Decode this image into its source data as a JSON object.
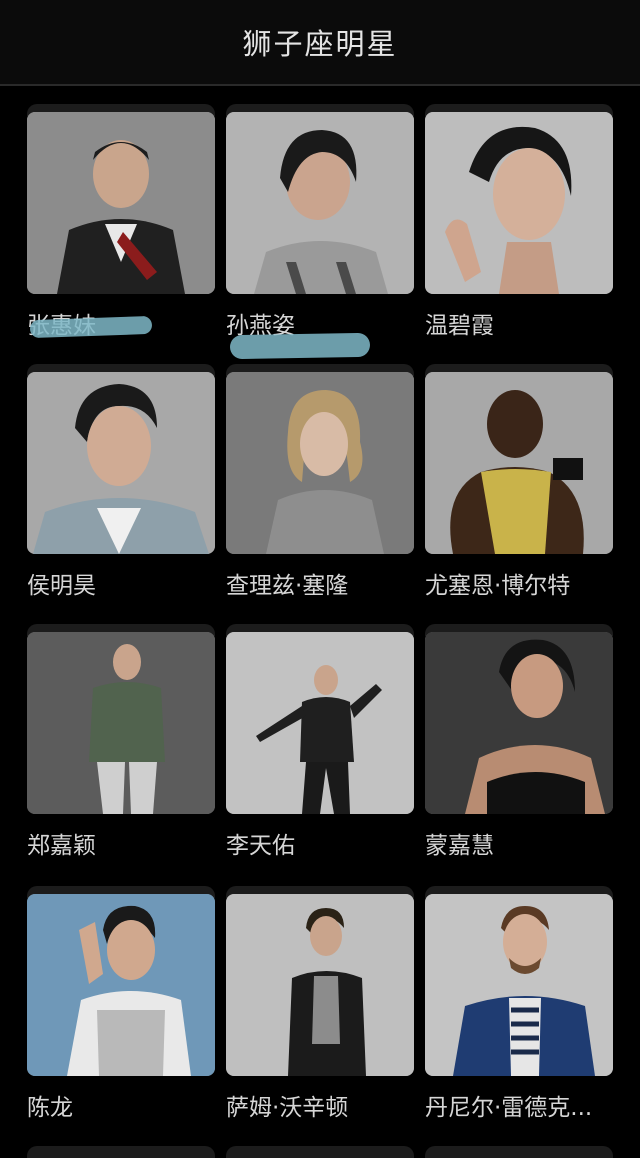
{
  "header": {
    "title": "狮子座明星"
  },
  "celebrities": [
    {
      "name": "张惠妹",
      "photo_icon": "person-photo-icon"
    },
    {
      "name": "孙燕姿",
      "photo_icon": "person-photo-icon"
    },
    {
      "name": "温碧霞",
      "photo_icon": "person-photo-icon"
    },
    {
      "name": "侯明昊",
      "photo_icon": "person-photo-icon"
    },
    {
      "name": "查理兹·塞隆",
      "photo_icon": "person-photo-icon"
    },
    {
      "name": "尤塞恩·博尔特",
      "photo_icon": "person-photo-icon"
    },
    {
      "name": "郑嘉颖",
      "photo_icon": "person-photo-icon"
    },
    {
      "name": "李天佑",
      "photo_icon": "person-photo-icon"
    },
    {
      "name": "蒙嘉慧",
      "photo_icon": "person-photo-icon"
    },
    {
      "name": "陈龙",
      "photo_icon": "person-photo-icon"
    },
    {
      "name": "萨姆·沃辛顿",
      "photo_icon": "person-photo-icon"
    },
    {
      "name": "丹尼尔·雷德克...",
      "photo_icon": "person-photo-icon"
    }
  ],
  "colors": {
    "background": "#000000",
    "header_bg": "#0b0b0b",
    "text": "#d6d6d6",
    "scribble": "#7fb8c8"
  }
}
